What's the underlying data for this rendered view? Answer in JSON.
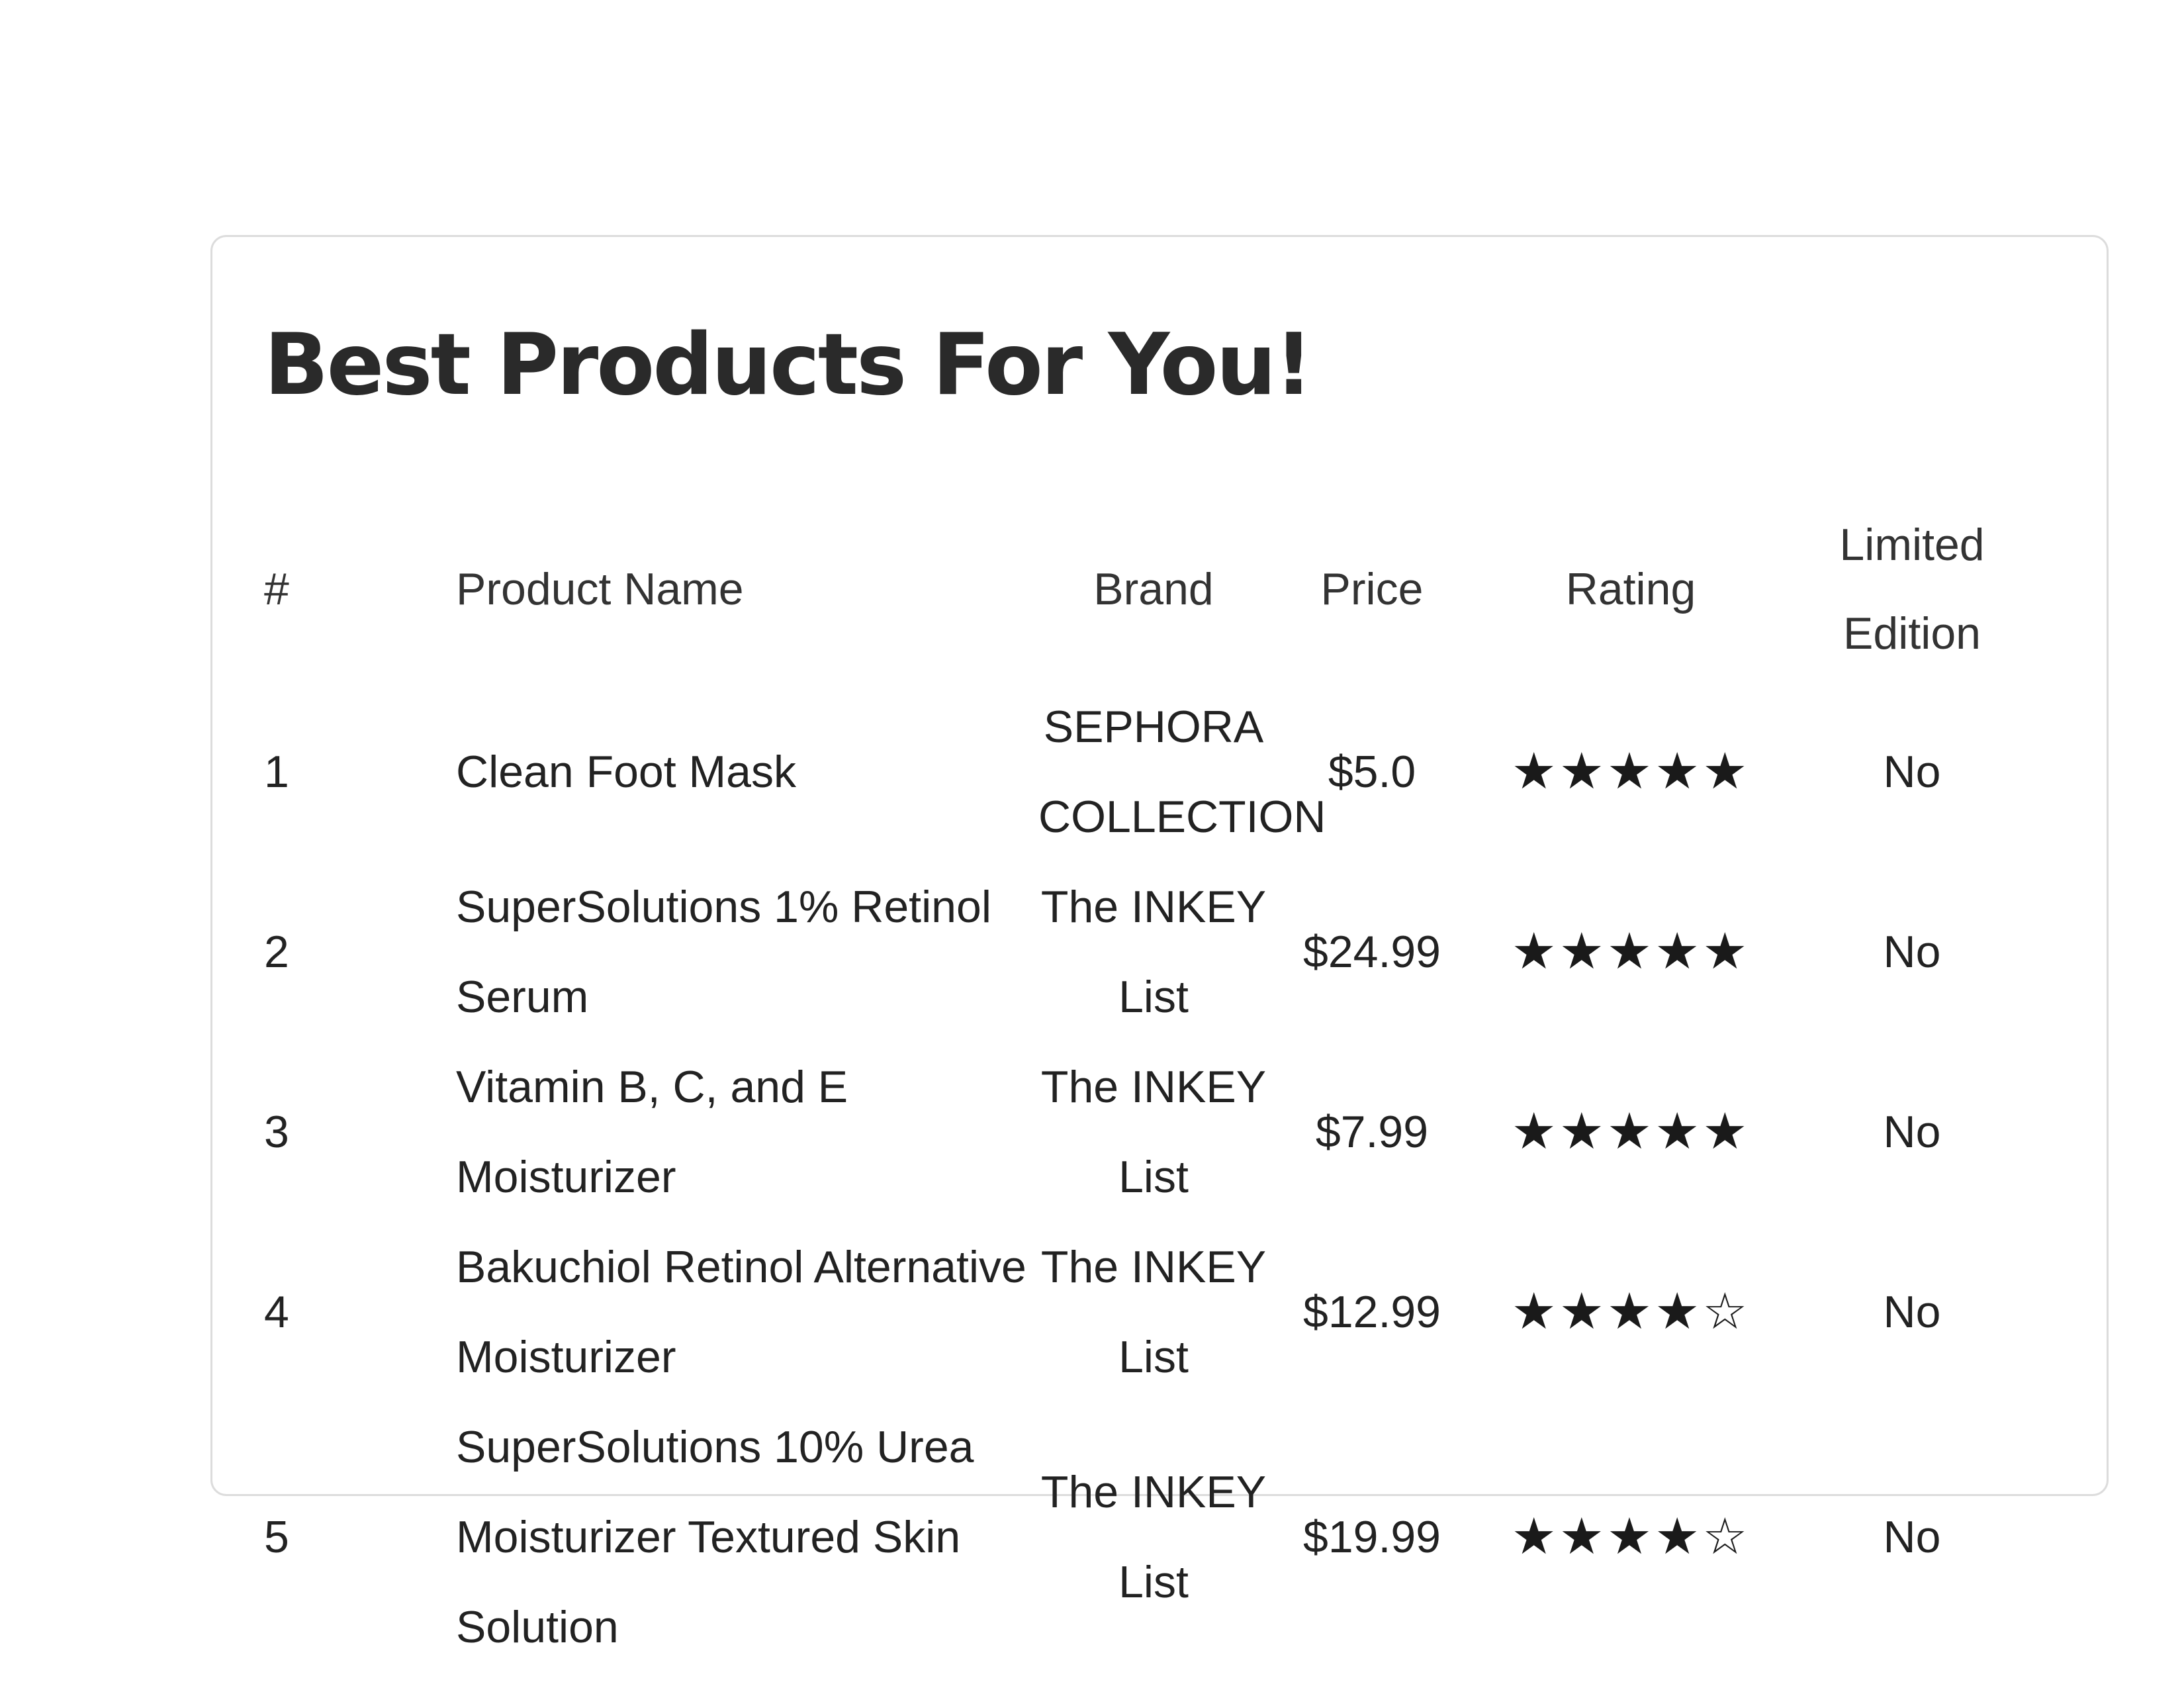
{
  "title": "Best Products For You!",
  "table": {
    "headers": {
      "num": "#",
      "name": "Product Name",
      "brand": "Brand",
      "price": "Price",
      "rating": "Rating",
      "limited": "Limited Edition"
    },
    "rows": [
      {
        "num": "1",
        "name": "Clean Foot Mask",
        "brand": "SEPHORA COLLECTION",
        "price": "$5.0",
        "rating": 5,
        "limited": "No"
      },
      {
        "num": "2",
        "name": "SuperSolutions 1% Retinol Serum",
        "brand": "The INKEY List",
        "price": "$24.99",
        "rating": 5,
        "limited": "No"
      },
      {
        "num": "3",
        "name": "Vitamin B, C, and E Moisturizer",
        "brand": "The INKEY List",
        "price": "$7.99",
        "rating": 5,
        "limited": "No"
      },
      {
        "num": "4",
        "name": "Bakuchiol Retinol Alternative Moisturizer",
        "brand": "The INKEY List",
        "price": "$12.99",
        "rating": 4,
        "limited": "No"
      },
      {
        "num": "5",
        "name": "SuperSolutions 10% Urea Moisturizer Textured Skin Solution",
        "brand": "The INKEY List",
        "price": "$19.99",
        "rating": 4,
        "limited": "No"
      }
    ]
  },
  "rating_max": 5,
  "icons": {
    "full_star": "star-filled-icon",
    "empty_star": "star-outline-icon"
  }
}
